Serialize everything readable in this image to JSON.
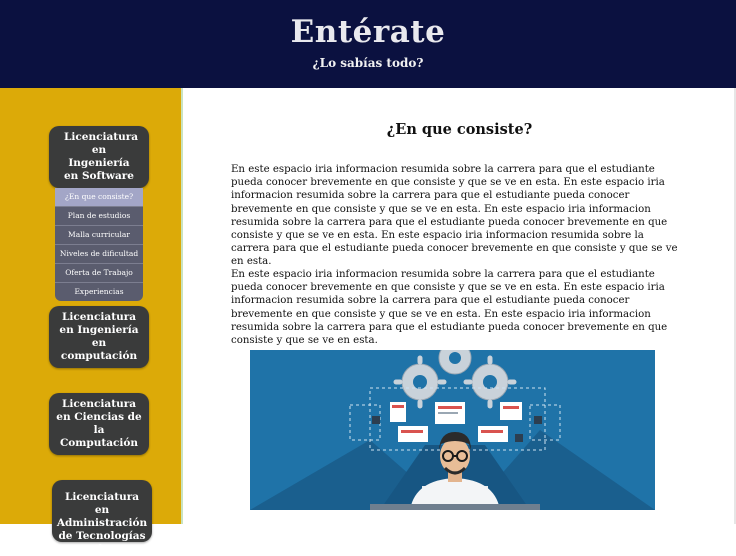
{
  "header": {
    "title": "Entérate",
    "subtitle": "¿Lo sabías todo?"
  },
  "sidebar": {
    "cards": [
      {
        "label": "Licenciatura en Ingeniería en Software"
      },
      {
        "label": "Licenciatura en Ingeniería en computación"
      },
      {
        "label": "Licenciatura en Ciencias de la Computación"
      },
      {
        "label": "Licenciatura en Administración de Tecnologías de"
      }
    ],
    "submenu": [
      {
        "label": "¿En que consiste?",
        "active": true
      },
      {
        "label": "Plan de estudios",
        "active": false
      },
      {
        "label": "Malla curricular",
        "active": false
      },
      {
        "label": "Niveles de dificultad",
        "active": false
      },
      {
        "label": "Oferta de Trabajo",
        "active": false
      },
      {
        "label": "Experiencias",
        "active": false
      }
    ]
  },
  "main": {
    "heading": "¿En que consiste?",
    "paragraphs": [
      "En este espacio iria informacion resumida sobre la carrera para que el estudiante pueda conocer brevemente en que consiste y que se ve en esta. En este espacio iria informacion resumida sobre la carrera para que el estudiante pueda conocer brevemente en que consiste y que se ve en esta. En este espacio iria informacion resumida sobre la carrera para que el estudiante pueda conocer brevemente en que consiste y que se ve en esta. En este espacio iria informacion resumida sobre la carrera para que el estudiante pueda conocer brevemente en que consiste y que se ve en esta.",
      "En este espacio iria informacion resumida sobre la carrera para que el estudiante pueda conocer brevemente en que consiste y que se ve en esta. En este espacio iria informacion resumida sobre la carrera para que el estudiante pueda conocer brevemente en que consiste y que se ve en esta. En este espacio iria informacion resumida sobre la carrera para que el estudiante pueda conocer brevemente en que consiste y que se ve en esta."
    ],
    "illustration_icon": "developer-gears-illustration"
  },
  "colors": {
    "header_bg": "#0b1140",
    "sidebar_bg": "#dcaa08",
    "card_bg": "#3a3b3b",
    "submenu_bg": "#5a5c6e",
    "submenu_active": "#a3a6c7",
    "illustration_bg": "#1f73a8"
  }
}
